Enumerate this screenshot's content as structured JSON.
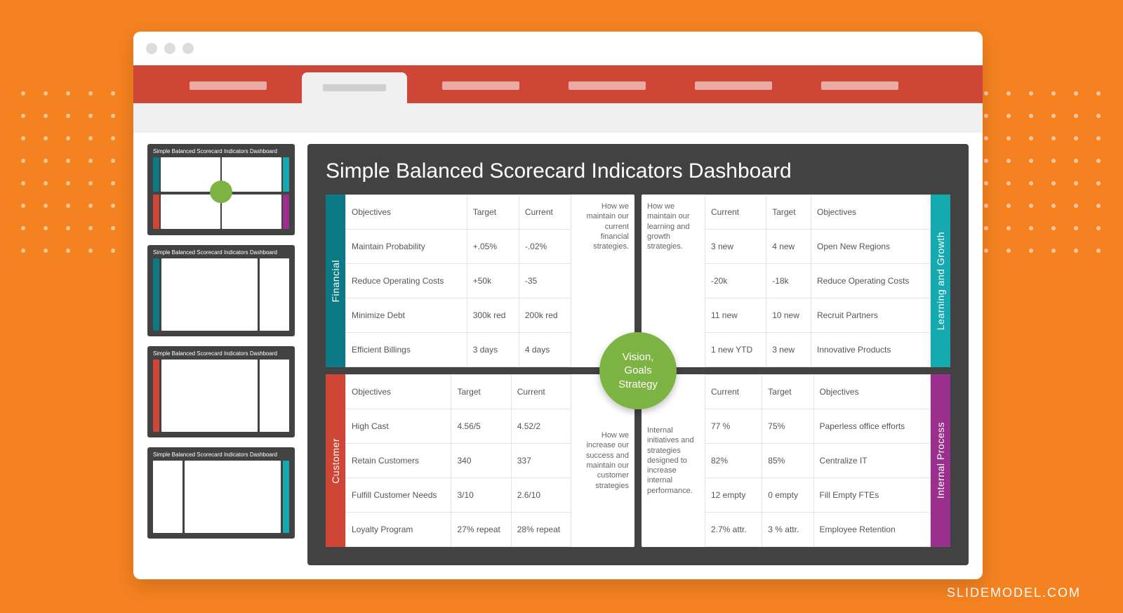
{
  "watermark": "SLIDEMODEL.COM",
  "slideTitle": "Simple Balanced Scorecard Indicators Dashboard",
  "centerCircle": "Vision,\nGoals\nStrategy",
  "financial": {
    "label": "Financial",
    "note": "How we maintain our current financial strategies.",
    "headers": {
      "objectives": "Objectives",
      "target": "Target",
      "current": "Current"
    },
    "rows": [
      {
        "objective": "Maintain Probability",
        "target": "+.05%",
        "current": "-.02%"
      },
      {
        "objective": "Reduce Operating Costs",
        "target": "+50k",
        "current": "-35"
      },
      {
        "objective": "Minimize Debt",
        "target": "300k red",
        "current": "200k red"
      },
      {
        "objective": "Efficient Billings",
        "target": "3 days",
        "current": "4 days"
      }
    ]
  },
  "customer": {
    "label": "Customer",
    "note": "How we increase our success and maintain our customer strategies",
    "headers": {
      "objectives": "Objectives",
      "target": "Target",
      "current": "Current"
    },
    "rows": [
      {
        "objective": "High Cast",
        "target": "4.56/5",
        "current": "4.52/2"
      },
      {
        "objective": "Retain Customers",
        "target": "340",
        "current": "337"
      },
      {
        "objective": "Fulfill Customer Needs",
        "target": "3/10",
        "current": "2.6/10"
      },
      {
        "objective": "Loyalty Program",
        "target": "27% repeat",
        "current": "28% repeat"
      }
    ]
  },
  "learning": {
    "label": "Learning and Growth",
    "note": "How we maintain our learning and growth strategies.",
    "headers": {
      "current": "Current",
      "target": "Target",
      "objectives": "Objectives"
    },
    "rows": [
      {
        "current": "3 new",
        "target": "4 new",
        "objective": "Open New Regions"
      },
      {
        "current": "-20k",
        "target": "-18k",
        "objective": "Reduce Operating Costs"
      },
      {
        "current": "11 new",
        "target": "10 new",
        "objective": "Recruit Partners"
      },
      {
        "current": "1 new YTD",
        "target": "3 new",
        "objective": "Innovative Products"
      }
    ]
  },
  "internal": {
    "label": "Internal Process",
    "note": "Internal initiatives and strategies designed to increase internal performance.",
    "headers": {
      "current": "Current",
      "target": "Target",
      "objectives": "Objectives"
    },
    "rows": [
      {
        "current": "77 %",
        "target": "75%",
        "objective": "Paperless office efforts"
      },
      {
        "current": "82%",
        "target": "85%",
        "objective": "Centralize IT"
      },
      {
        "current": "12 empty",
        "target": "0 empty",
        "objective": "Fill Empty FTEs"
      },
      {
        "current": "2.7% attr.",
        "target": "3 % attr.",
        "objective": "Employee Retention"
      }
    ]
  },
  "thumbs": {
    "t1": "Simple Balanced Scorecard Indicators Dashboard",
    "t2": "Simple Balanced Scorecard Indicators Dashboard",
    "t3": "Simple Balanced Scorecard Indicators Dashboard",
    "t4": "Simple Balanced Scorecard Indicators Dashboard"
  }
}
